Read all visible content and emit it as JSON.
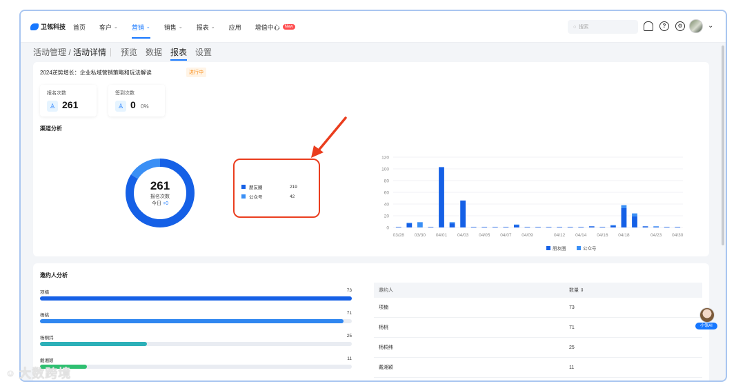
{
  "app": {
    "logo_text": "卫瓴科技"
  },
  "nav": [
    {
      "label": "首页",
      "caret": false,
      "active": false
    },
    {
      "label": "客户",
      "caret": true,
      "active": false
    },
    {
      "label": "营销",
      "caret": true,
      "active": true
    },
    {
      "label": "销售",
      "caret": true,
      "active": false
    },
    {
      "label": "报表",
      "caret": true,
      "active": false
    },
    {
      "label": "应用",
      "caret": false,
      "active": false
    },
    {
      "label": "增值中心",
      "caret": false,
      "active": false,
      "badge": "New"
    }
  ],
  "search": {
    "placeholder": "搜索"
  },
  "breadcrumb": {
    "parent": "活动管理 / ",
    "current": "活动详情"
  },
  "tabs": [
    "预览",
    "数据",
    "报表",
    "设置"
  ],
  "active_tab": "报表",
  "activity": {
    "title": "2024逆势增长：企业私域营销策略和玩法解读",
    "status": "进行中"
  },
  "stats": [
    {
      "label": "报名次数",
      "value": "261",
      "pct": ""
    },
    {
      "label": "签到次数",
      "value": "0",
      "pct": "0%"
    }
  ],
  "channel": {
    "section_title": "渠道分析",
    "total": "261",
    "total_label": "报名次数",
    "today_label": "今日",
    "today_value": "+0",
    "items": [
      {
        "name": "朋友圈",
        "value": 219,
        "color": "#1560e6"
      },
      {
        "name": "公众号",
        "value": 42,
        "color": "#3a8ff5"
      }
    ]
  },
  "chart_data": {
    "type": "bar",
    "stacked": true,
    "categories": [
      "03/28",
      "03/29",
      "03/30",
      "03/31",
      "04/01",
      "04/02",
      "04/03",
      "04/04",
      "04/05",
      "04/06",
      "04/07",
      "04/08",
      "04/09",
      "04/10",
      "04/11",
      "04/12",
      "04/13",
      "04/14",
      "04/15",
      "04/16",
      "04/17",
      "04/18",
      "04/19",
      "04/20",
      "04/23",
      "04/29",
      "04/30"
    ],
    "tick_labels": [
      "03/28",
      "03/30",
      "04/01",
      "04/03",
      "04/05",
      "04/07",
      "04/09",
      "04/12",
      "04/14",
      "04/16",
      "04/18",
      "04/23",
      "04/30"
    ],
    "series": [
      {
        "name": "朋友圈",
        "color": "#1560e6",
        "values": [
          1,
          7,
          0,
          1,
          103,
          7,
          46,
          1,
          1,
          1,
          1,
          4,
          1,
          1,
          1,
          1,
          1,
          1,
          2,
          1,
          3,
          33,
          19,
          2,
          1,
          1,
          1
        ]
      },
      {
        "name": "公众号",
        "color": "#3a8ff5",
        "values": [
          0,
          1,
          9,
          0,
          0,
          2,
          0,
          0,
          0,
          0,
          0,
          1,
          0,
          0,
          0,
          0,
          0,
          0,
          0,
          0,
          1,
          5,
          5,
          0,
          1,
          0,
          0
        ]
      }
    ],
    "ylim": [
      0,
      120
    ],
    "yticks": [
      0,
      20,
      40,
      60,
      80,
      100,
      120
    ],
    "grid": true,
    "legend": "bottom"
  },
  "inviters": {
    "section_title": "邀约人分析",
    "max": 73,
    "items": [
      {
        "name": "项楠",
        "value": 73,
        "color": "#1560e6"
      },
      {
        "name": "杨桃",
        "value": 71,
        "color": "#2f86f0"
      },
      {
        "name": "杨桐纬",
        "value": 25,
        "color": "#2cb0b8"
      },
      {
        "name": "戴湘颖",
        "value": 11,
        "color": "#2fbf71"
      }
    ]
  },
  "table": {
    "headers": {
      "name": "邀约人",
      "count": "数量 ⇕"
    },
    "rows": [
      {
        "name": "项楠",
        "count": "73"
      },
      {
        "name": "杨桃",
        "count": "71"
      },
      {
        "name": "杨桐纬",
        "count": "25"
      },
      {
        "name": "戴湘颖",
        "count": "11"
      }
    ]
  },
  "assistant": {
    "label": "小瓴AI"
  },
  "watermark": {
    "text": "大数跨境"
  }
}
